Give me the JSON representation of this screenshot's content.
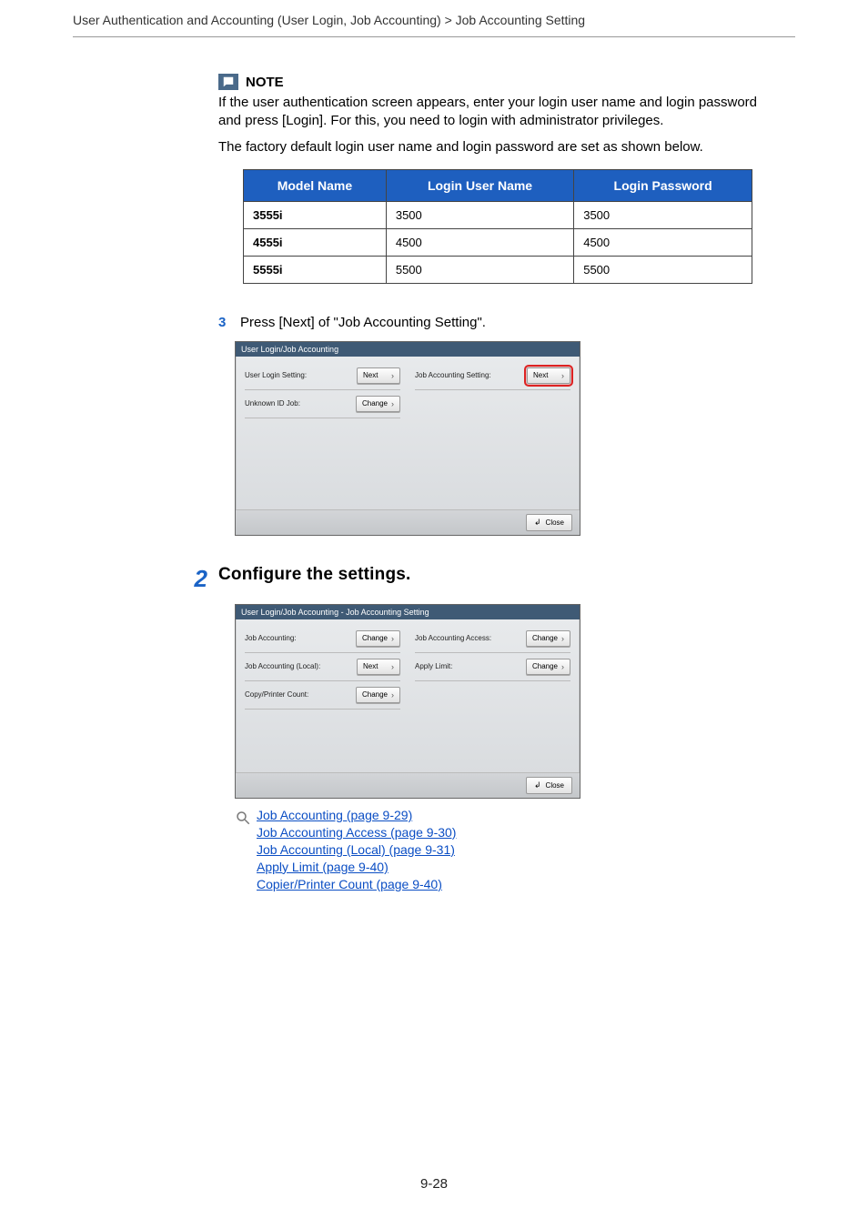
{
  "breadcrumb": "User Authentication and Accounting (User Login, Job Accounting) > Job Accounting Setting",
  "note": {
    "label": "NOTE",
    "p1": "If the user authentication screen appears, enter your login user name and login password and press [Login]. For this, you need to login with administrator privileges.",
    "p2": "The factory default login user name and login password are set as shown below."
  },
  "login_table": {
    "headers": {
      "model": "Model Name",
      "user": "Login User Name",
      "pass": "Login Password"
    },
    "rows": [
      {
        "model": "3555i",
        "user": "3500",
        "pass": "3500"
      },
      {
        "model": "4555i",
        "user": "4500",
        "pass": "4500"
      },
      {
        "model": "5555i",
        "user": "5500",
        "pass": "5500"
      }
    ]
  },
  "step3": {
    "num": "3",
    "text": "Press [Next] of \"Job Accounting Setting\"."
  },
  "panel1": {
    "title": "User Login/Job Accounting",
    "rows": [
      {
        "label": "User Login Setting:",
        "btn": "Next"
      },
      {
        "label": "Job Accounting Setting:",
        "btn": "Next",
        "highlight": true
      },
      {
        "label": "Unknown ID Job:",
        "btn": "Change"
      }
    ],
    "close": "Close"
  },
  "bigstep2": {
    "num": "2",
    "title": "Configure the settings."
  },
  "panel2": {
    "title": "User Login/Job Accounting - Job Accounting Setting",
    "rows": [
      {
        "label": "Job Accounting:",
        "btn": "Change"
      },
      {
        "label": "Job Accounting Access:",
        "btn": "Change"
      },
      {
        "label": "Job Accounting (Local):",
        "btn": "Next"
      },
      {
        "label": "Apply Limit:",
        "btn": "Change"
      },
      {
        "label": "Copy/Printer Count:",
        "btn": "Change"
      }
    ],
    "close": "Close"
  },
  "links": {
    "l1": "Job Accounting (page 9-29)",
    "l2": "Job Accounting Access (page 9-30)",
    "l3": "Job Accounting (Local) (page 9-31)",
    "l4": "Apply Limit (page 9-40)",
    "l5": "Copier/Printer Count (page 9-40)"
  },
  "page_number": "9-28"
}
